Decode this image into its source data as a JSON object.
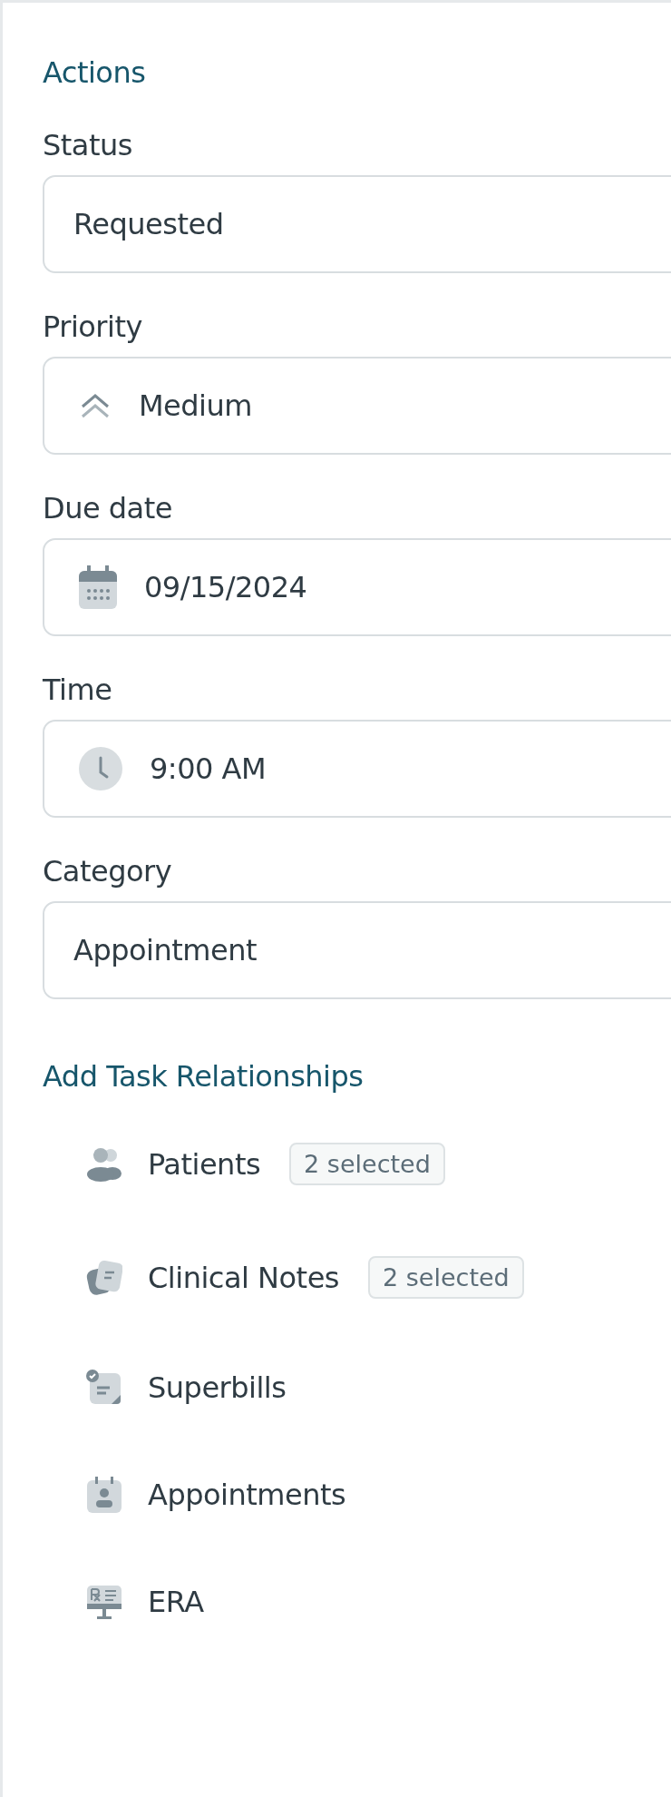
{
  "actions": {
    "title": "Actions",
    "fields": [
      {
        "label": "Status",
        "kind": "select",
        "value": "Requested"
      },
      {
        "label": "Priority",
        "kind": "priority",
        "value": "Medium"
      },
      {
        "label": "Due date",
        "kind": "date",
        "value": "09/15/2024"
      },
      {
        "label": "Time",
        "kind": "time",
        "value": "9:00 AM"
      },
      {
        "label": "Category",
        "kind": "select",
        "value": "Appointment"
      }
    ]
  },
  "relationships": {
    "title": "Add Task Relationships",
    "items": [
      {
        "kind": "patients",
        "label": "Patients",
        "badge": "2 selected"
      },
      {
        "kind": "notes",
        "label": "Clinical Notes",
        "badge": "2 selected"
      },
      {
        "kind": "superbills",
        "label": "Superbills"
      },
      {
        "kind": "appointments",
        "label": "Appointments"
      },
      {
        "kind": "era",
        "label": "ERA"
      }
    ]
  }
}
